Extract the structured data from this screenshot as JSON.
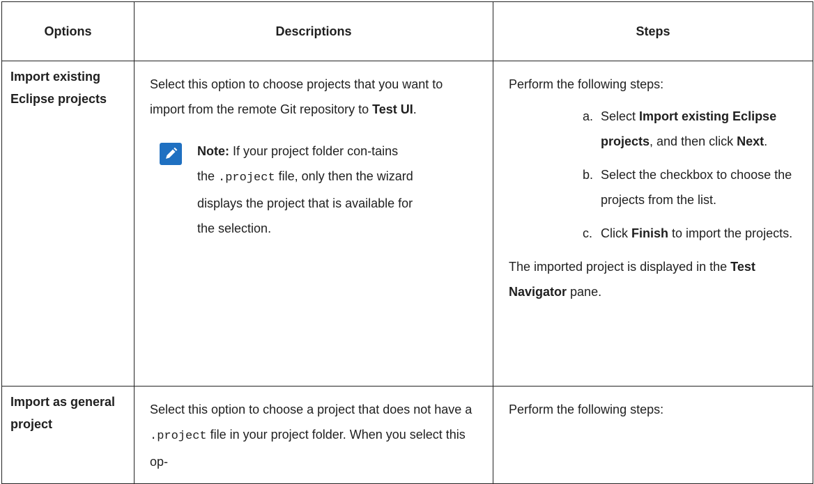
{
  "header": {
    "options": "Options",
    "descriptions": "Descriptions",
    "steps": "Steps"
  },
  "rows": [
    {
      "option": "Import existing Eclipse projects",
      "description": {
        "text_before": "Select this option to choose projects that you want to import from the remote Git repository to ",
        "bold_target": "Test UI",
        "text_after": ".",
        "note": {
          "label": "Note:",
          "text_1": " If your project folder con-tains the ",
          "code": ".project",
          "text_2": " file, only then the wizard displays the project that is available for the selection."
        }
      },
      "steps": {
        "intro": "Perform the following steps:",
        "items": [
          {
            "marker": "a.",
            "t1": "Select ",
            "b1": "Import existing Eclipse projects",
            "t2": ", and then click ",
            "b2": "Next",
            "t3": "."
          },
          {
            "marker": "b.",
            "t1": "Select the checkbox to choose the projects from the list."
          },
          {
            "marker": "c.",
            "t1": "Click ",
            "b1": "Finish",
            "t2": " to import the projects."
          }
        ],
        "outro_1": "The imported project is displayed in the ",
        "outro_bold": "Test Navigator",
        "outro_2": " pane."
      }
    },
    {
      "option": "Import as general project",
      "description": {
        "text_before": "Select this option to choose a project that does not have a ",
        "code": ".project",
        "text_after": " file in your project folder. When you select this op-"
      },
      "steps": {
        "intro": "Perform the following steps:"
      }
    }
  ],
  "colors": {
    "note_icon_bg": "#1f70c1",
    "border": "#222222"
  },
  "icons": {
    "note": "pencil-note-icon"
  }
}
